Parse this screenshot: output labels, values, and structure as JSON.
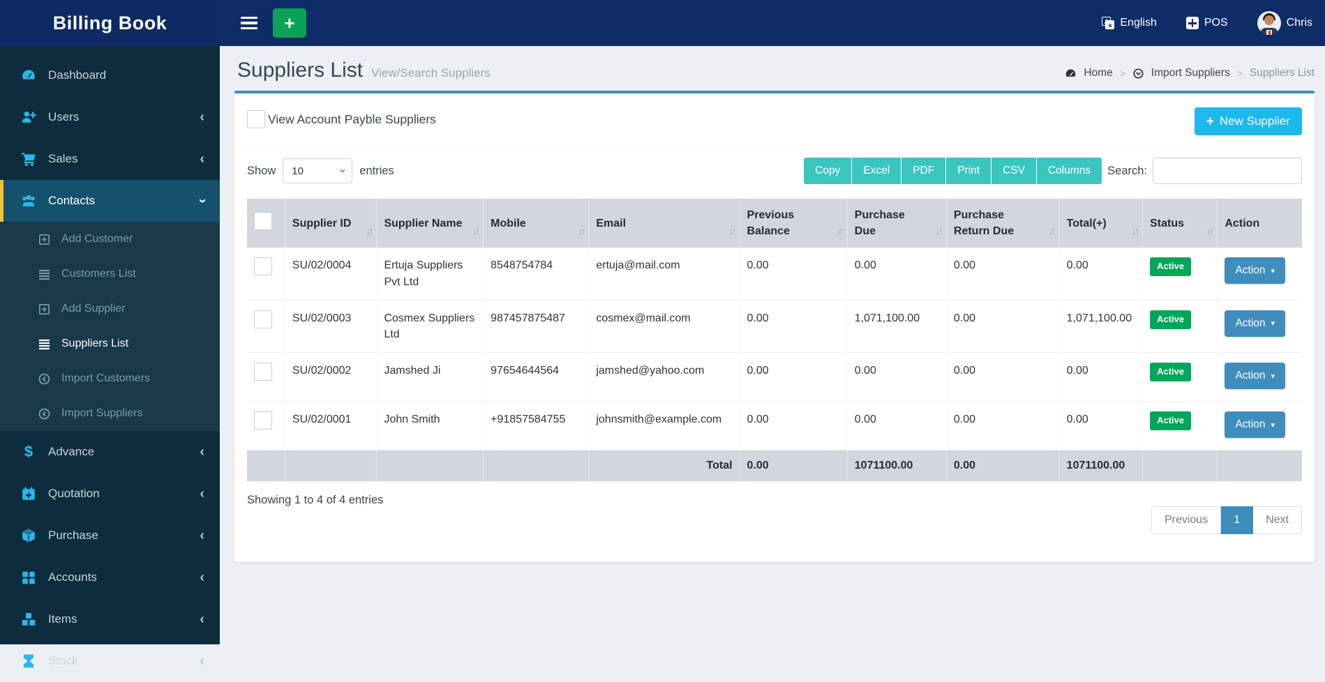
{
  "brand": {
    "title": "Billing Book"
  },
  "navbar": {
    "language_label": "English",
    "pos_label": "POS",
    "username": "Chris"
  },
  "sidebar": {
    "items": [
      {
        "label": "Dashboard"
      },
      {
        "label": "Users"
      },
      {
        "label": "Sales"
      },
      {
        "label": "Contacts"
      },
      {
        "label": "Advance"
      },
      {
        "label": "Quotation"
      },
      {
        "label": "Purchase"
      },
      {
        "label": "Accounts"
      },
      {
        "label": "Items"
      },
      {
        "label": "Stock"
      }
    ],
    "contacts_submenu": [
      {
        "label": "Add Customer"
      },
      {
        "label": "Customers List"
      },
      {
        "label": "Add Supplier"
      },
      {
        "label": "Suppliers List"
      },
      {
        "label": "Import Customers"
      },
      {
        "label": "Import Suppliers"
      }
    ]
  },
  "header": {
    "title": "Suppliers List",
    "subtitle": "View/Search Suppliers",
    "breadcrumb": {
      "home": "Home",
      "import_suppliers": "Import Suppliers",
      "current": "Suppliers List"
    }
  },
  "controls": {
    "payble_checkbox_label": "View Account Payble Suppliers",
    "new_supplier_label": "New Supplier",
    "show_label": "Show",
    "page_size": "10",
    "entries_label": "entries",
    "export_buttons": [
      "Copy",
      "Excel",
      "PDF",
      "Print",
      "CSV",
      "Columns"
    ],
    "search_label": "Search:"
  },
  "table": {
    "columns": [
      "Supplier ID",
      "Supplier Name",
      "Mobile",
      "Email",
      "Previous Balance",
      "Purchase Due",
      "Purchase Return Due",
      "Total(+)",
      "Status",
      "Action"
    ],
    "action_label": "Action",
    "rows": [
      {
        "supplier_id": "SU/02/0004",
        "supplier_name": "Ertuja Suppliers Pvt Ltd",
        "mobile": "8548754784",
        "email": "ertuja@mail.com",
        "previous_balance": "0.00",
        "purchase_due": "0.00",
        "purchase_return_due": "0.00",
        "total": "0.00",
        "status": "Active"
      },
      {
        "supplier_id": "SU/02/0003",
        "supplier_name": "Cosmex Suppliers Ltd",
        "mobile": "987457875487",
        "email": "cosmex@mail.com",
        "previous_balance": "0.00",
        "purchase_due": "1,071,100.00",
        "purchase_return_due": "0.00",
        "total": "1,071,100.00",
        "status": "Active"
      },
      {
        "supplier_id": "SU/02/0002",
        "supplier_name": "Jamshed Ji",
        "mobile": "97654644564",
        "email": "jamshed@yahoo.com",
        "previous_balance": "0.00",
        "purchase_due": "0.00",
        "purchase_return_due": "0.00",
        "total": "0.00",
        "status": "Active"
      },
      {
        "supplier_id": "SU/02/0001",
        "supplier_name": "John Smith",
        "mobile": "+91857584755",
        "email": "johnsmith@example.com",
        "previous_balance": "0.00",
        "purchase_due": "0.00",
        "purchase_return_due": "0.00",
        "total": "0.00",
        "status": "Active"
      }
    ],
    "total_row": {
      "label": "Total",
      "previous_balance": "0.00",
      "purchase_due": "1071100.00",
      "purchase_return_due": "0.00",
      "total": "1071100.00"
    }
  },
  "footer": {
    "showing": "Showing 1 to 4 of 4 entries",
    "pagination": {
      "previous": "Previous",
      "page": "1",
      "next": "Next"
    }
  },
  "colors": {
    "navbar_navy": "#0e2c68",
    "green_plus": "#0ba255",
    "sidebar_dark": "#0d2c3c",
    "sidebar_active": "#14516d",
    "active_yellow": "#f0c330",
    "icon_cyan": "#29b7ea",
    "panel_top_border": "#3e8cbd",
    "teal_export": "#3ac5bf",
    "cyan_new_supplier": "#1db8ec",
    "badge_green": "#00a65a",
    "action_blue": "#3f8dbd",
    "table_header_gray": "#d2d6de"
  }
}
